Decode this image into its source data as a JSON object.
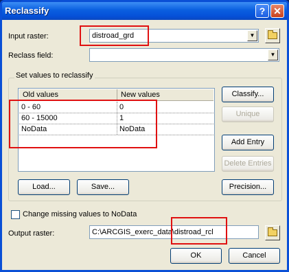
{
  "window": {
    "title": "Reclassify"
  },
  "input_raster": {
    "label": "Input raster:",
    "value": "distroad_grd"
  },
  "reclass_field": {
    "label": "Reclass field:",
    "value": ""
  },
  "group": {
    "label": "Set values to reclassify"
  },
  "table": {
    "columns": [
      "Old values",
      "New values"
    ],
    "rows": [
      {
        "old": "0 - 60",
        "new": "0"
      },
      {
        "old": "60 - 15000",
        "new": "1"
      },
      {
        "old": "NoData",
        "new": "NoData"
      }
    ]
  },
  "side_buttons": {
    "classify": "Classify...",
    "unique": "Unique",
    "add_entry": "Add Entry",
    "delete_entries": "Delete Entries",
    "precision": "Precision..."
  },
  "bottom_buttons": {
    "load": "Load...",
    "save": "Save..."
  },
  "change_missing": {
    "label": "Change missing values to NoData",
    "checked": false
  },
  "output_raster": {
    "label": "Output raster:",
    "value": "C:\\ARCGIS_exerc_data\\distroad_rcl"
  },
  "dialog_buttons": {
    "ok": "OK",
    "cancel": "Cancel"
  },
  "colors": {
    "highlight_box": "#e01010",
    "titlebar": "#0a5fe0"
  }
}
